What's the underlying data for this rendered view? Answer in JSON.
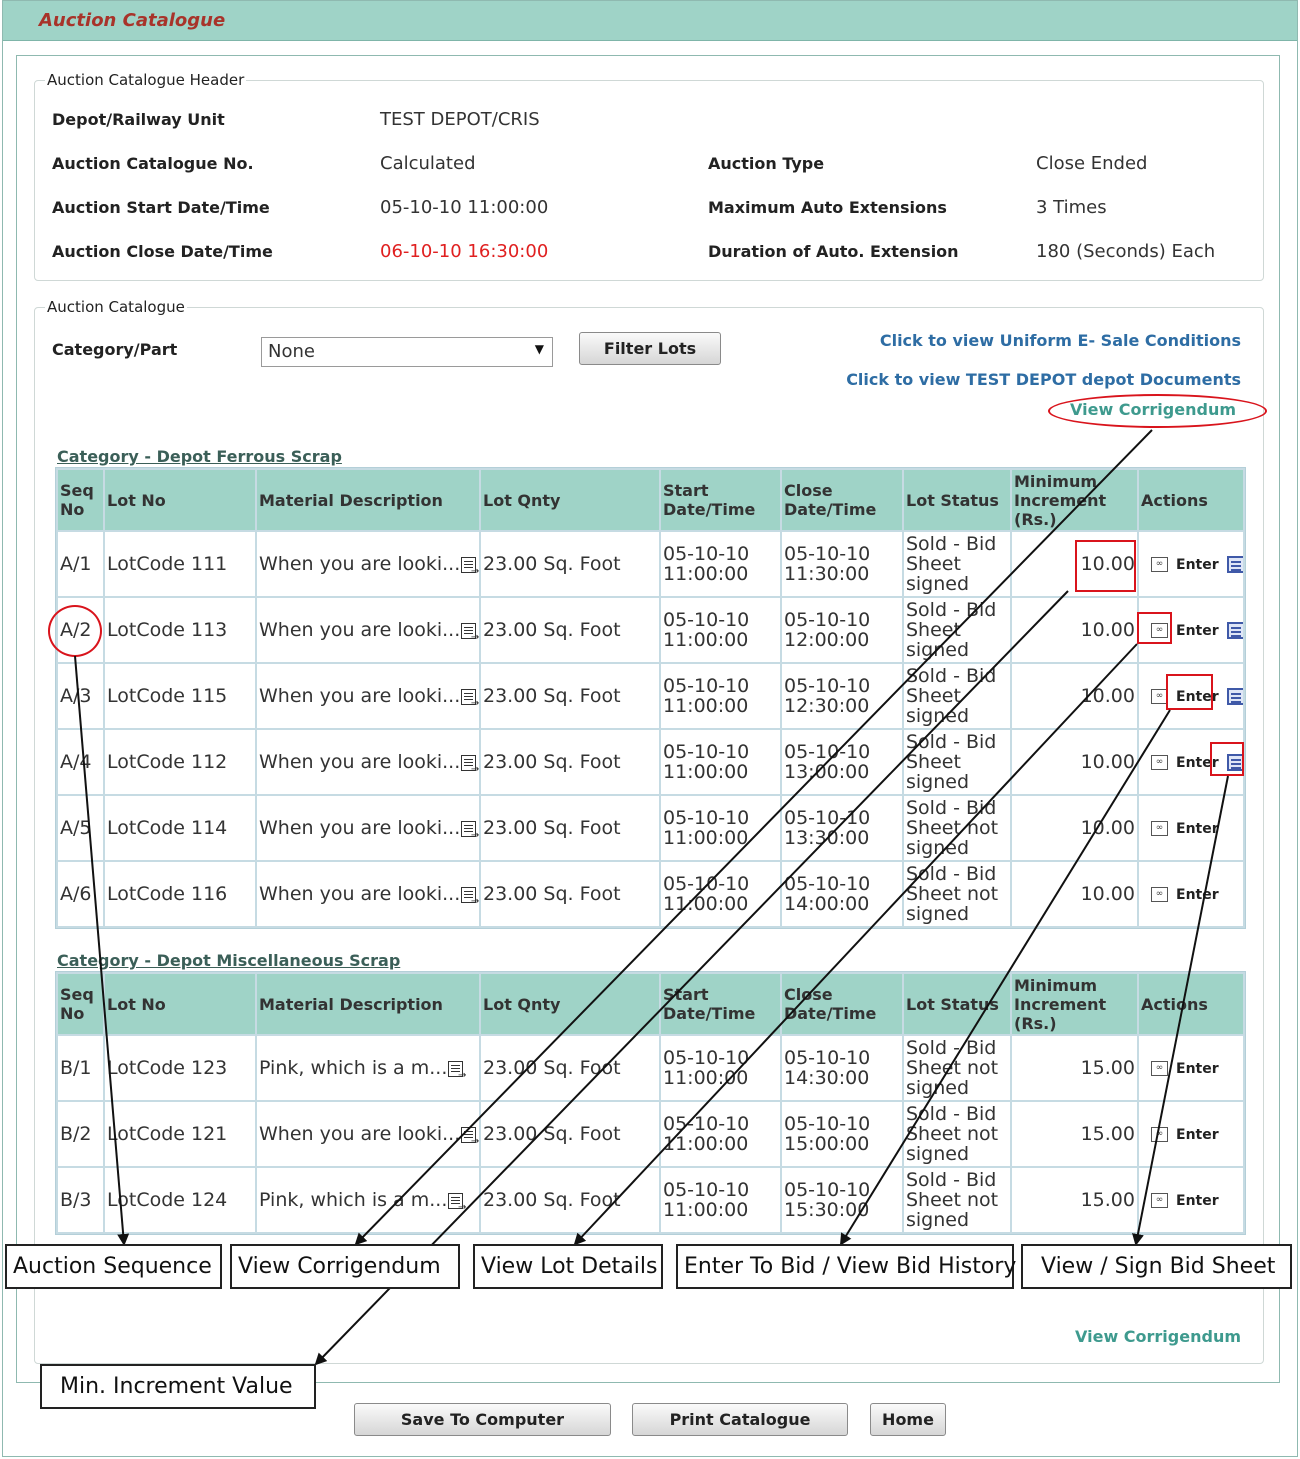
{
  "page": {
    "title": "Auction Catalogue"
  },
  "header_section": {
    "legend": "Auction Catalogue Header",
    "depot_label": "Depot/Railway Unit",
    "depot_value": "TEST DEPOT/CRIS",
    "catalogue_no_label": "Auction Catalogue No.",
    "catalogue_no_value": "Calculated",
    "auction_type_label": "Auction Type",
    "auction_type_value": "Close Ended",
    "start_label": "Auction Start Date/Time",
    "start_value": "05-10-10 11:00:00",
    "max_ext_label": "Maximum Auto Extensions",
    "max_ext_value": "3 Times",
    "close_label": "Auction Close Date/Time",
    "close_value": "06-10-10 16:30:00",
    "duration_label": "Duration of Auto. Extension",
    "duration_value": "180 (Seconds) Each"
  },
  "catalogue_section": {
    "legend": "Auction Catalogue",
    "category_label": "Category/Part",
    "category_value": "None",
    "filter_button": "Filter Lots",
    "uniform_link": "Click to view Uniform E- Sale Conditions",
    "depot_docs_link": "Click to view TEST DEPOT depot Documents",
    "corrigendum_link": "View Corrigendum",
    "corrigendum_link_bottom": "View Corrigendum"
  },
  "columns": {
    "seq": "Seq No",
    "lot": "Lot No",
    "desc": "Material Description",
    "qty": "Lot Qnty",
    "start": "Start Date/Time",
    "close": "Close Date/Time",
    "status": "Lot Status",
    "min_inc": "Minimum Increment (Rs.)",
    "actions": "Actions"
  },
  "action_labels": {
    "enter": "Enter"
  },
  "categories": [
    {
      "title": "Category - Depot Ferrous Scrap",
      "rows": [
        {
          "seq": "A/1",
          "lot": "LotCode 111",
          "desc": "When you are looki...",
          "qty": "23.00 Sq. Foot",
          "start": "05-10-10 11:00:00",
          "close": "05-10-10 11:30:00",
          "status": "Sold - Bid Sheet signed",
          "min_inc": "10.00"
        },
        {
          "seq": "A/2",
          "lot": "LotCode 113",
          "desc": "When you are looki...",
          "qty": "23.00 Sq. Foot",
          "start": "05-10-10 11:00:00",
          "close": "05-10-10 12:00:00",
          "status": "Sold - Bid Sheet signed",
          "min_inc": "10.00"
        },
        {
          "seq": "A/3",
          "lot": "LotCode 115",
          "desc": "When you are looki...",
          "qty": "23.00 Sq. Foot",
          "start": "05-10-10 11:00:00",
          "close": "05-10-10 12:30:00",
          "status": "Sold - Bid Sheet signed",
          "min_inc": "10.00"
        },
        {
          "seq": "A/4",
          "lot": "LotCode 112",
          "desc": "When you are looki...",
          "qty": "23.00 Sq. Foot",
          "start": "05-10-10 11:00:00",
          "close": "05-10-10 13:00:00",
          "status": "Sold - Bid Sheet signed",
          "min_inc": "10.00"
        },
        {
          "seq": "A/5",
          "lot": "LotCode 114",
          "desc": "When you are looki...",
          "qty": "23.00 Sq. Foot",
          "start": "05-10-10 11:00:00",
          "close": "05-10-10 13:30:00",
          "status": "Sold - Bid Sheet not signed",
          "min_inc": "10.00"
        },
        {
          "seq": "A/6",
          "lot": "LotCode 116",
          "desc": "When you are looki...",
          "qty": "23.00 Sq. Foot",
          "start": "05-10-10 11:00:00",
          "close": "05-10-10 14:00:00",
          "status": "Sold - Bid Sheet not signed",
          "min_inc": "10.00"
        }
      ]
    },
    {
      "title": "Category - Depot Miscellaneous Scrap",
      "rows": [
        {
          "seq": "B/1",
          "lot": "LotCode 123",
          "desc": "Pink, which is a m...",
          "qty": "23.00 Sq. Foot",
          "start": "05-10-10 11:00:00",
          "close": "05-10-10 14:30:00",
          "status": "Sold - Bid Sheet not signed",
          "min_inc": "15.00"
        },
        {
          "seq": "B/2",
          "lot": "LotCode 121",
          "desc": "When you are looki...",
          "qty": "23.00 Sq. Foot",
          "start": "05-10-10 11:00:00",
          "close": "05-10-10 15:00:00",
          "status": "Sold - Bid Sheet not signed",
          "min_inc": "15.00"
        },
        {
          "seq": "B/3",
          "lot": "LotCode 124",
          "desc": "Pink, which is a m...",
          "qty": "23.00 Sq. Foot",
          "start": "05-10-10 11:00:00",
          "close": "05-10-10 15:30:00",
          "status": "Sold - Bid Sheet not signed",
          "min_inc": "15.00"
        }
      ]
    }
  ],
  "bottom_buttons": {
    "save": "Save To Computer",
    "print": "Print Catalogue",
    "home": "Home"
  },
  "callouts": {
    "sequence": "Auction Sequence",
    "corrigendum": "View Corrigendum",
    "lot_details": "View Lot Details",
    "enter_bid": "Enter To Bid / View Bid History",
    "sign_sheet": "View / Sign Bid Sheet",
    "min_increment": "Min. Increment Value"
  },
  "colors": {
    "header_teal": "#9fd3c7",
    "title_red": "#a8332a",
    "link_blue": "#2e6da4",
    "link_green": "#3e9a8e",
    "highlight_red": "#d9141c"
  }
}
